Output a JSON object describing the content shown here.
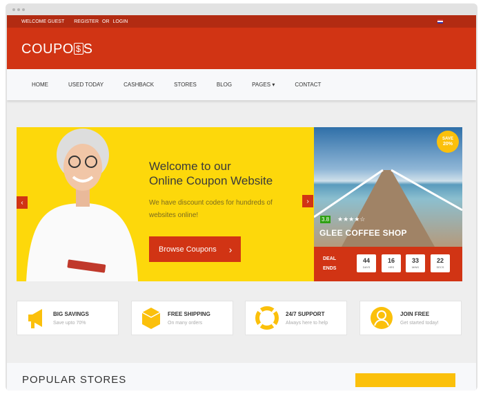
{
  "topbar": {
    "welcome": "WELCOME GUEST",
    "register": "REGISTER",
    "or": "OR",
    "login": "LOGIN",
    "flag_icon": "uk-flag-icon"
  },
  "logo": "COUPONS",
  "nav": [
    {
      "label": "HOME"
    },
    {
      "label": "USED TODAY"
    },
    {
      "label": "CASHBACK"
    },
    {
      "label": "STORES"
    },
    {
      "label": "BLOG"
    },
    {
      "label": "PAGES ▾"
    },
    {
      "label": "CONTACT"
    }
  ],
  "hero": {
    "title_line1": "Welcome to our",
    "title_line2": "Online Coupon Website",
    "subtitle": "We have discount codes for hundreds of websites online!",
    "button": "Browse Coupons",
    "button_icon": "›"
  },
  "deal": {
    "save_line1": "SAVE",
    "save_line2": "20%",
    "rating": "3.8",
    "stars": "★★★★☆",
    "stars_value": 3.8,
    "shop": "GLEE COFFEE SHOP",
    "ends_line1": "DEAL",
    "ends_line2": "ENDS",
    "countdown": [
      {
        "value": "44",
        "unit": "DAYS"
      },
      {
        "value": "16",
        "unit": "HRS"
      },
      {
        "value": "33",
        "unit": "MINS"
      },
      {
        "value": "22",
        "unit": "SECS"
      }
    ]
  },
  "features": [
    {
      "title": "BIG SAVINGS",
      "sub": "Save upto 70%",
      "icon": "megaphone-icon"
    },
    {
      "title": "FREE SHIPPING",
      "sub": "On many orders",
      "icon": "box-icon"
    },
    {
      "title": "24/7 SUPPORT",
      "sub": "Always here to help",
      "icon": "lifebuoy-icon"
    },
    {
      "title": "JOIN FREE",
      "sub": "Get started today!",
      "icon": "user-icon"
    }
  ],
  "section_title": "POPULAR STORES",
  "colors": {
    "brand_red": "#d13414",
    "accent_yellow": "#fdd80b",
    "icon_yellow": "#fbc00b"
  }
}
